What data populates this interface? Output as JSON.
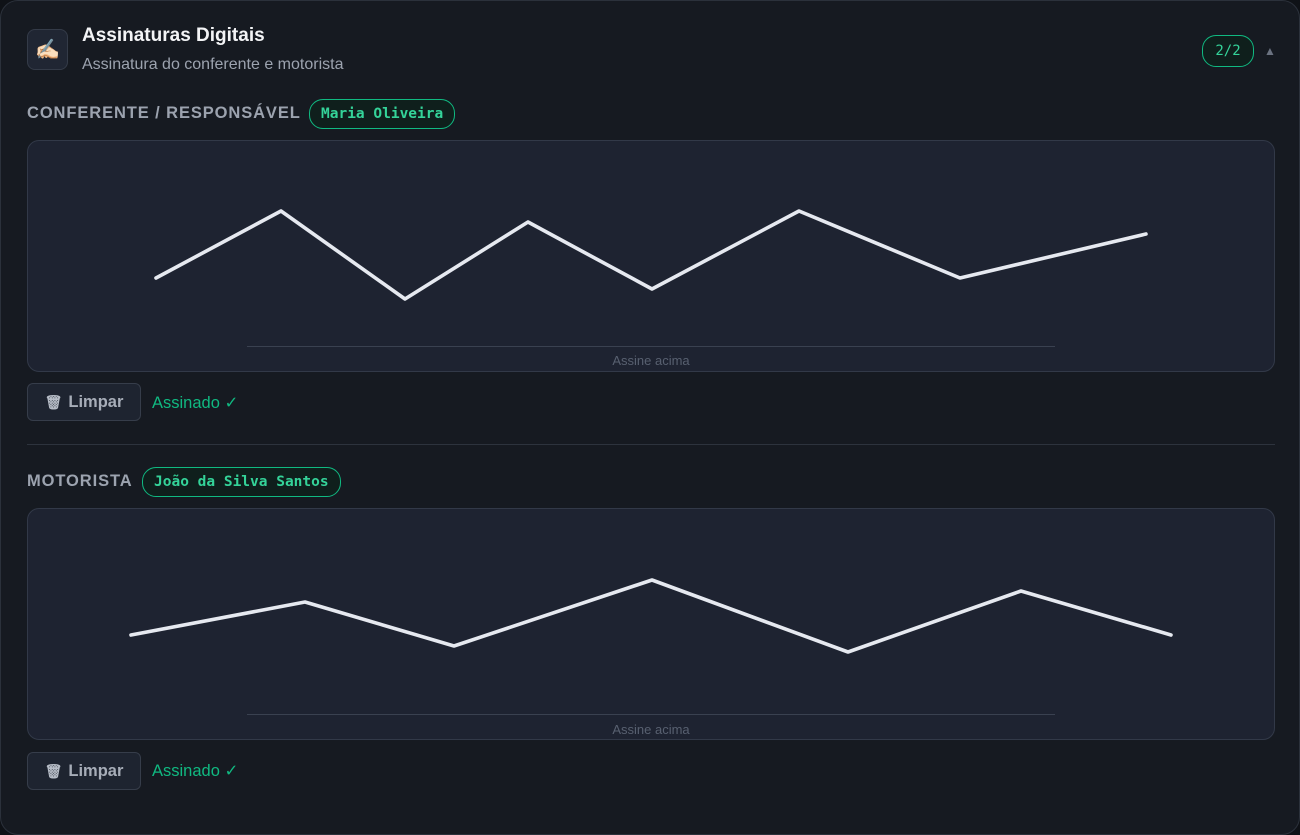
{
  "header": {
    "icon": "writing-hand-icon",
    "icon_glyph": "✍🏻",
    "title": "Assinaturas Digitais",
    "subtitle": "Assinatura do conferente e motorista",
    "counter": "2/2",
    "collapse_glyph": "▲"
  },
  "sections": [
    {
      "label": "CONFERENTE / RESPONSÁVEL",
      "name": "Maria Oliveira",
      "hint": "Assine acima",
      "clear_label": "Limpar",
      "clear_icon": "🗑",
      "status": "Assinado ✓"
    },
    {
      "label": "MOTORISTA",
      "name": "João da Silva Santos",
      "hint": "Assine acima",
      "clear_label": "Limpar",
      "clear_icon": "🗑",
      "status": "Assinado ✓"
    }
  ],
  "colors": {
    "accent": "#10b981",
    "stroke": "#e6e9f0",
    "pad_background": "#1e2331"
  }
}
